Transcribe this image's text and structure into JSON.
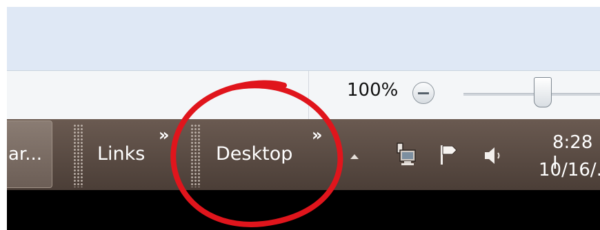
{
  "status_bar": {
    "zoom_level": "100%"
  },
  "taskbar": {
    "task_button_label": "ar...",
    "toolbars": [
      {
        "label": "Links",
        "chevron": "»"
      },
      {
        "label": "Desktop",
        "chevron": "»"
      }
    ],
    "clock": {
      "time": "8:28 I",
      "date": "10/16/."
    }
  },
  "icons": {
    "zoom_out": "minus-circle-icon",
    "network": "network-icon",
    "action_center": "flag-icon",
    "volume": "speaker-icon",
    "show_hidden": "triangle-up-icon"
  },
  "colors": {
    "taskbar": "#5b4c44",
    "annotation": "#e0151c"
  }
}
